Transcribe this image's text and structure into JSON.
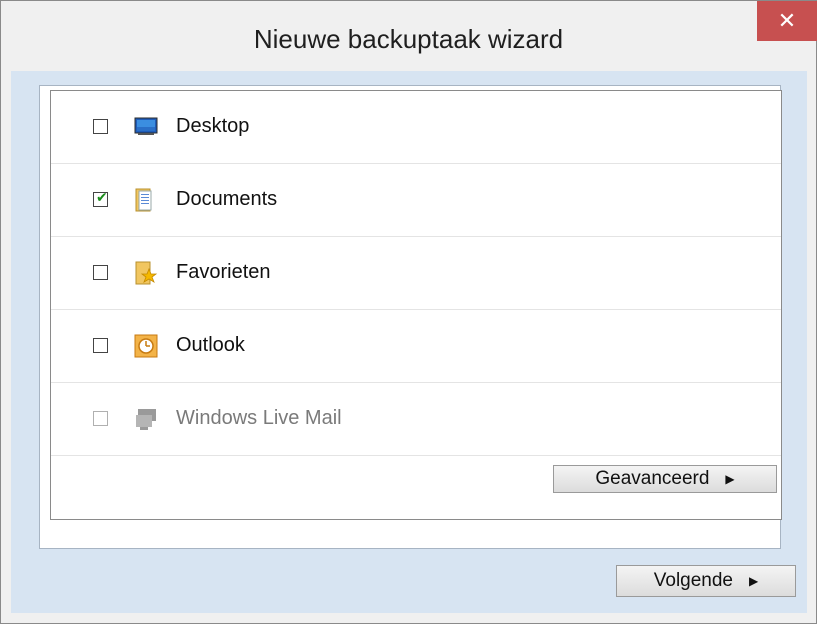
{
  "window": {
    "title": "Nieuwe backuptaak wizard",
    "close_label": "✕"
  },
  "items": [
    {
      "label": "Desktop",
      "checked": false,
      "enabled": true,
      "icon": "desktop-icon"
    },
    {
      "label": "Documents",
      "checked": true,
      "enabled": true,
      "icon": "documents-folder-icon"
    },
    {
      "label": "Favorieten",
      "checked": false,
      "enabled": true,
      "icon": "favorites-folder-icon"
    },
    {
      "label": "Outlook",
      "checked": false,
      "enabled": true,
      "icon": "outlook-icon"
    },
    {
      "label": "Windows Live Mail",
      "checked": false,
      "enabled": false,
      "icon": "windows-live-mail-icon"
    }
  ],
  "buttons": {
    "advanced_label": "Geavanceerd",
    "next_label": "Volgende",
    "arrow_glyph": "▶"
  },
  "colors": {
    "client_background": "#d7e4f2",
    "close_button": "#c75050",
    "check_color": "#1a8c1a"
  }
}
